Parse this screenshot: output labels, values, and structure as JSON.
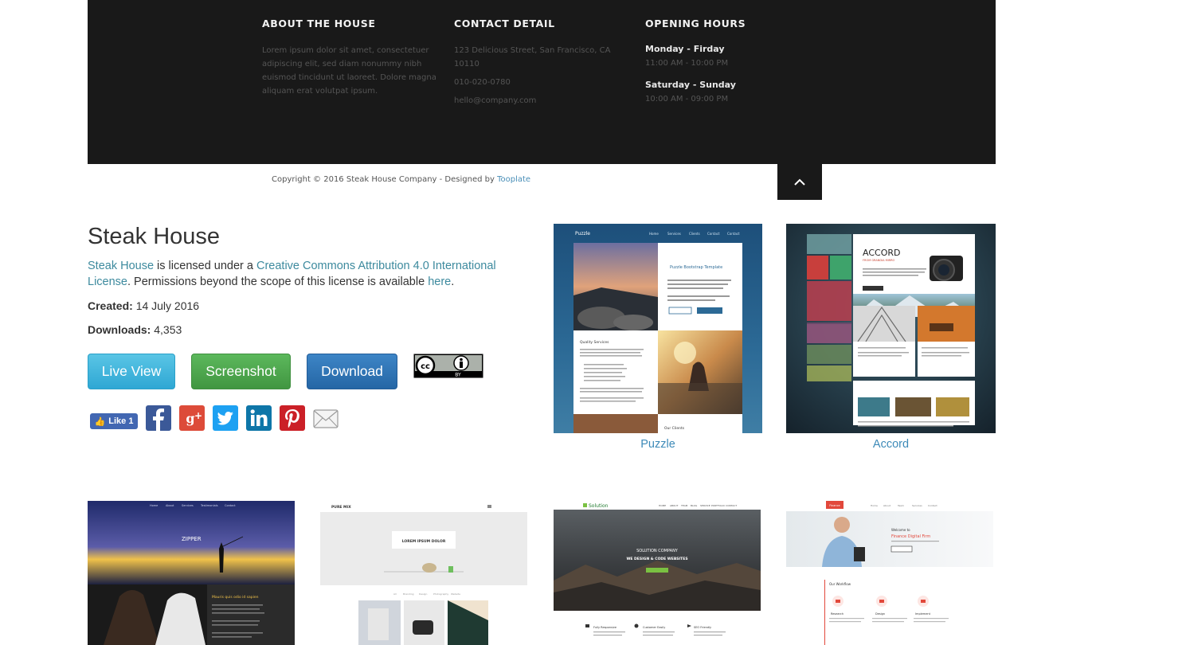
{
  "footer": {
    "about": {
      "heading": "ABOUT THE HOUSE",
      "text": "Lorem ipsum dolor sit amet, consectetuer adipiscing elit, sed diam nonummy nibh euismod tincidunt ut laoreet. Dolore magna aliquam erat volutpat ipsum."
    },
    "contact": {
      "heading": "CONTACT DETAIL",
      "address": "123 Delicious Street, San Francisco, CA 10110",
      "phone": "010-020-0780",
      "email": "hello@company.com"
    },
    "hours": {
      "heading": "OPENING HOURS",
      "weekday_label": "Monday - Firday",
      "weekday_time": "11:00 AM - 10:00 PM",
      "weekend_label": "Saturday - Sunday",
      "weekend_time": "10:00 AM - 09:00 PM"
    },
    "copyright_prefix": "Copyright © 2016 Steak House Company - Designed by ",
    "copyright_link": "Tooplate",
    "to_top_icon": "chevron-up-icon"
  },
  "template": {
    "title": "Steak House",
    "license_name": "Steak House",
    "license_mid": " is licensed under a ",
    "license_link": "Creative Commons Attribution 4.0 International License",
    "license_after": ". Permissions beyond the scope of this license is available ",
    "license_here": "here",
    "license_end": ".",
    "created_label": "Created:",
    "created_value": "14 July 2016",
    "downloads_label": "Downloads:",
    "downloads_value": "4,353",
    "buttons": {
      "live": "Live View",
      "screenshot": "Screenshot",
      "download": "Download"
    },
    "cc_badge_text": "BY",
    "fb_like": "Like 1"
  },
  "colors": {
    "footer_bg": "#191919",
    "link": "#3d8a9e",
    "live_btn": "#31b0d5",
    "screenshot_btn": "#449d44",
    "download_btn": "#286090"
  },
  "related": [
    {
      "name": "Puzzle"
    },
    {
      "name": "Accord"
    }
  ],
  "thumb_texts": {
    "puzzle_nav": "Puzzle",
    "puzzle_heading": "Puzzle Bootstrap Template",
    "puzzle_services": "Quality Services",
    "puzzle_clients": "Our Clients",
    "accord_title": "ACCORD",
    "accord_sub": "FROM GRANDIA MIRRO",
    "zipper": "ZIPPER",
    "zipper_caption": "Mauris quis odio id sapien",
    "puremix_logo": "PURE MIX",
    "puremix_box": "LOREM IPSUM DOLOR",
    "solution_logo": "Solution",
    "solution_company": "SOLUTION COMPANY",
    "solution_tagline": "WE DESIGN & CODE WEBSITES",
    "finance_logo": "Finance",
    "finance_heading": "Finance Digital Firm"
  }
}
